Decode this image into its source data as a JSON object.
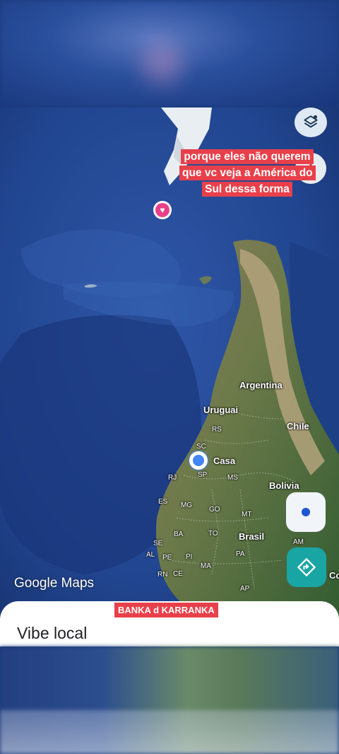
{
  "caption": "porque eles não querem que vc veja a América do Sul dessa forma",
  "credit": "BANKA d KARRANKA",
  "map": {
    "labels": {
      "argentina": "Argentina",
      "uruguai": "Uruguai",
      "chile": "Chile",
      "casa": "Casa",
      "bolivia": "Bolivia",
      "brasil": "Brasil",
      "co": "Co"
    },
    "states": [
      "RS",
      "SC",
      "SP",
      "MS",
      "RJ",
      "ES",
      "MG",
      "GO",
      "MT",
      "BA",
      "TO",
      "SE",
      "AL",
      "PE",
      "PI",
      "PA",
      "AM",
      "RN",
      "CE",
      "MA",
      "AP"
    ],
    "watermark": "Google Maps"
  },
  "sheet": {
    "title": "Vibe local"
  },
  "colors": {
    "ocean": "#1e3f8f",
    "land_green": "#3e6b3a",
    "land_tan": "#9a8a6a",
    "accent_red": "#e8404a",
    "directions_teal": "#1aa5a5",
    "location_blue": "#4285f4"
  },
  "icons": {
    "layers": "layers-icon",
    "compass": "compass-icon",
    "my_location": "my-location-icon",
    "directions": "directions-icon",
    "favorite_pin": "heart-icon",
    "home_pin": "home-location-icon"
  }
}
